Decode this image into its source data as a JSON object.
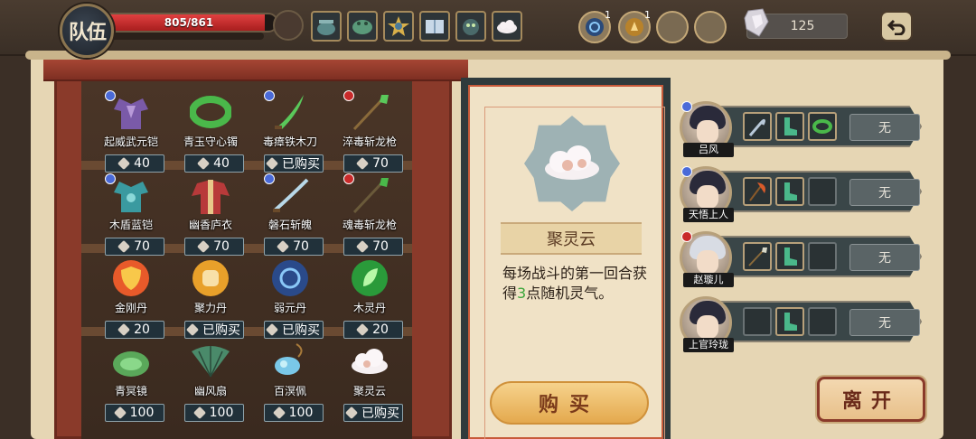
{
  "top_bar": {
    "team_label": "队伍",
    "hp_text": "805/861",
    "hp_fraction": 0.935,
    "relics": [
      "cauldron-icon",
      "jade-toad-icon",
      "star-emblem-icon",
      "book-icon",
      "beast-icon",
      "cloud-icon"
    ],
    "coins": [
      {
        "icon": "blue-orb-icon",
        "count": "1"
      },
      {
        "icon": "gold-orb-icon",
        "count": "1"
      },
      {
        "icon": "empty-slot",
        "count": ""
      },
      {
        "icon": "empty-slot",
        "count": ""
      }
    ],
    "spirit_stones": "125"
  },
  "shop": {
    "items": [
      {
        "name": "起威武元铠",
        "price": "40",
        "badge": "blue",
        "icon": "purple-armor-icon"
      },
      {
        "name": "青玉守心镯",
        "price": "40",
        "badge": "",
        "icon": "jade-bracelet-icon"
      },
      {
        "name": "毒瘴铁木刀",
        "price": "已购买",
        "badge": "blue",
        "icon": "green-blade-icon"
      },
      {
        "name": "淬毒斩龙枪",
        "price": "70",
        "badge": "red",
        "icon": "poison-spear-icon"
      },
      {
        "name": "木盾蓝铠",
        "price": "70",
        "badge": "blue",
        "icon": "teal-armor-icon"
      },
      {
        "name": "幽香庐衣",
        "price": "70",
        "badge": "",
        "icon": "red-robe-icon"
      },
      {
        "name": "磐石斩魄",
        "price": "70",
        "badge": "blue",
        "icon": "long-blade-icon"
      },
      {
        "name": "魂毒斩龙枪",
        "price": "70",
        "badge": "red",
        "icon": "soul-spear-icon"
      },
      {
        "name": "金刚丹",
        "price": "20",
        "badge": "",
        "icon": "shield-pill-icon"
      },
      {
        "name": "聚力丹",
        "price": "已购买",
        "badge": "",
        "icon": "fist-pill-icon"
      },
      {
        "name": "弱元丹",
        "price": "已购买",
        "badge": "",
        "icon": "swirl-pill-icon"
      },
      {
        "name": "木灵丹",
        "price": "20",
        "badge": "",
        "icon": "leaf-pill-icon"
      },
      {
        "name": "青冥镜",
        "price": "100",
        "badge": "",
        "icon": "jade-mirror-icon"
      },
      {
        "name": "幽风扇",
        "price": "100",
        "badge": "",
        "icon": "fan-icon"
      },
      {
        "name": "百溟佩",
        "price": "100",
        "badge": "",
        "icon": "pendant-icon"
      },
      {
        "name": "聚灵云",
        "price": "已购买",
        "badge": "",
        "icon": "spirit-cloud-icon"
      }
    ]
  },
  "detail": {
    "name": "聚灵云",
    "desc_prefix": "每场战斗的第一回合获得",
    "desc_highlight": "3",
    "desc_suffix": "点随机灵气。",
    "buy_label": "购买"
  },
  "team": {
    "members": [
      {
        "name": "吕风",
        "badge": "blue",
        "hair": "dark",
        "equips": [
          "hook-icon",
          "boots-icon",
          "bracelet-icon"
        ],
        "slot": "无"
      },
      {
        "name": "天悟上人",
        "badge": "blue",
        "hair": "dark",
        "equips": [
          "red-axe-icon",
          "boots-icon",
          ""
        ],
        "slot": "无"
      },
      {
        "name": "赵璇儿",
        "badge": "red",
        "hair": "light",
        "equips": [
          "spear-icon",
          "boots-icon",
          ""
        ],
        "slot": "无"
      },
      {
        "name": "上官玲珑",
        "badge": "",
        "hair": "dark",
        "equips": [
          "",
          "boots-icon",
          ""
        ],
        "slot": "无"
      }
    ]
  },
  "leave_label": "离开"
}
